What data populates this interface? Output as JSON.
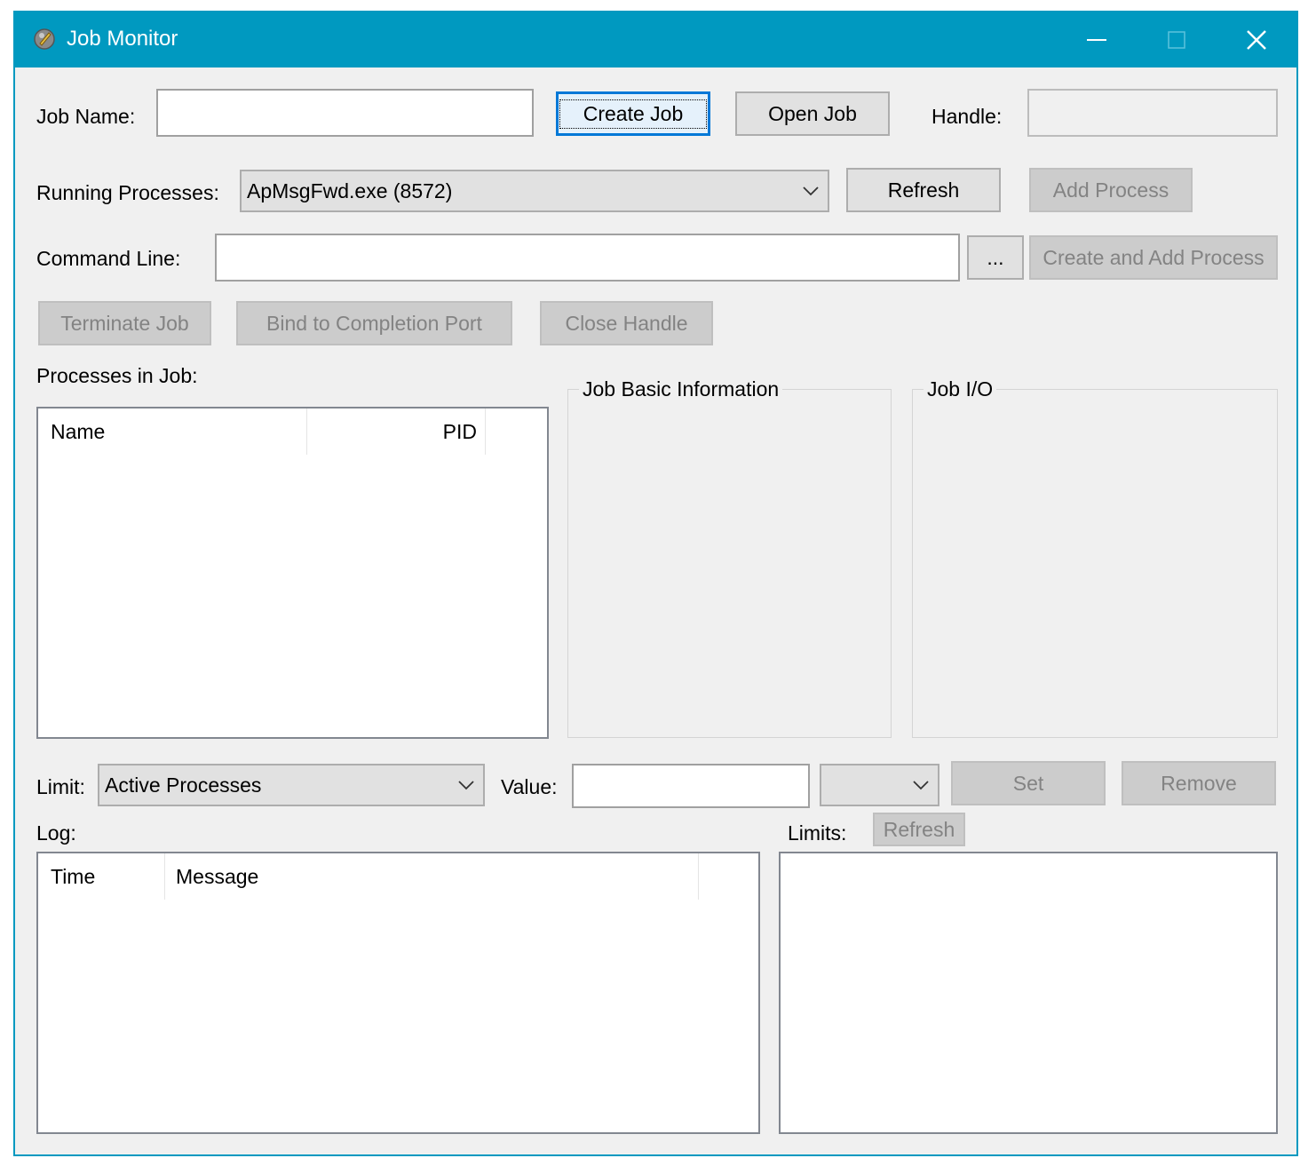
{
  "window": {
    "title": "Job Monitor"
  },
  "top": {
    "job_name_label": "Job Name:",
    "job_name_value": "",
    "create_job": "Create Job",
    "open_job": "Open Job",
    "handle_label": "Handle:",
    "handle_value": ""
  },
  "processes": {
    "label": "Running Processes:",
    "selected": "ApMsgFwd.exe (8572)",
    "refresh": "Refresh",
    "add_process": "Add Process"
  },
  "command": {
    "label": "Command Line:",
    "value": "",
    "browse": "...",
    "create_add": "Create and Add Process"
  },
  "actions": {
    "terminate": "Terminate Job",
    "bind": "Bind to Completion Port",
    "close": "Close Handle"
  },
  "job_processes": {
    "label": "Processes in Job:",
    "columns": [
      "Name",
      "PID"
    ]
  },
  "groups": {
    "basic": "Job Basic Information",
    "io": "Job I/O"
  },
  "limit": {
    "label": "Limit:",
    "selected": "Active Processes",
    "value_label": "Value:",
    "value": "",
    "unit": "",
    "set": "Set",
    "remove": "Remove"
  },
  "log": {
    "label": "Log:",
    "columns": [
      "Time",
      "Message"
    ]
  },
  "limits": {
    "label": "Limits:",
    "refresh": "Refresh"
  }
}
